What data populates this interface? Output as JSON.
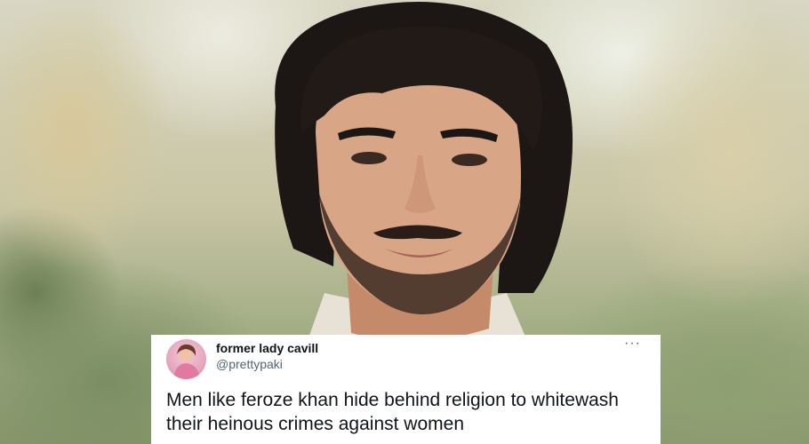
{
  "tweet": {
    "display_name": "former lady cavill",
    "handle": "@prettypaki",
    "more_label": "···",
    "text": "Men like feroze khan hide behind religion to whitewash their heinous crimes against women"
  },
  "colors": {
    "card_bg": "#ffffff",
    "name_color": "#0f1419",
    "handle_color": "#536471",
    "hair": "#1c1714",
    "skin": "#d9a587"
  },
  "icons": {
    "more": "more-options-icon",
    "avatar": "avatar-photo"
  }
}
